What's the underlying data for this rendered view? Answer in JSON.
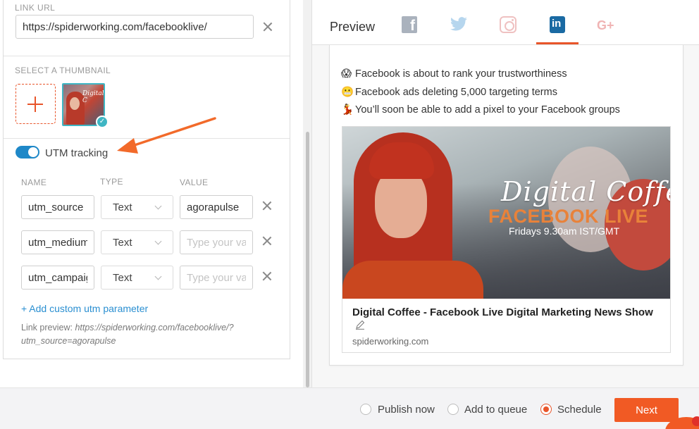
{
  "link_url": {
    "label": "LINK URL",
    "value": "https://spiderworking.com/facebooklive/"
  },
  "thumbnail": {
    "label": "SELECT A THUMBNAIL",
    "image_text": "Digital C"
  },
  "utm": {
    "toggle_label": "UTM tracking",
    "enabled": true,
    "columns": {
      "name": "NAME",
      "type": "TYPE",
      "value": "VALUE"
    },
    "rows": [
      {
        "name": "utm_source",
        "type": "Text",
        "value": "agorapulse",
        "placeholder": "Type your value"
      },
      {
        "name": "utm_medium",
        "type": "Text",
        "value": "",
        "placeholder": "Type your value"
      },
      {
        "name": "utm_campaign",
        "type": "Text",
        "value": "",
        "placeholder": "Type your value"
      }
    ],
    "add_param": "+ Add custom utm parameter",
    "link_preview_label": "Link preview:",
    "link_preview_url": "https://spiderworking.com/facebooklive/?utm_source=agorapulse"
  },
  "preview": {
    "title": "Preview",
    "networks": [
      "facebook-icon",
      "twitter-icon",
      "instagram-icon",
      "linkedin-icon",
      "google-plus-icon"
    ],
    "active_network": "linkedin",
    "facebook_glyph": "f",
    "linkedin_glyph": "in",
    "google_plus_glyph": "G+",
    "post_lines": [
      {
        "emoji": "😱",
        "text": "Facebook is about to rank your trustworthiness"
      },
      {
        "emoji": "😬",
        "text": "Facebook ads deleting 5,000 targeting terms"
      },
      {
        "emoji": "💃",
        "text": "You’ll soon be able to add a pixel to your Facebook groups"
      }
    ],
    "article": {
      "image_script": "Digital Coffee",
      "image_headline": "FACEBOOK LIVE",
      "image_subtitle": "Fridays 9.30am IST/GMT",
      "title": "Digital Coffee - Facebook Live Digital Marketing News Show",
      "domain": "spiderworking.com"
    }
  },
  "footer": {
    "options": [
      "Publish now",
      "Add to queue",
      "Schedule"
    ],
    "selected": "Schedule",
    "next_label": "Next"
  },
  "colors": {
    "accent": "#e8552a",
    "toggle": "#1e88c8",
    "link": "#2a8fd1",
    "linkedin": "#1a6aa3",
    "thumbnail_selected": "#3fb6c4"
  }
}
